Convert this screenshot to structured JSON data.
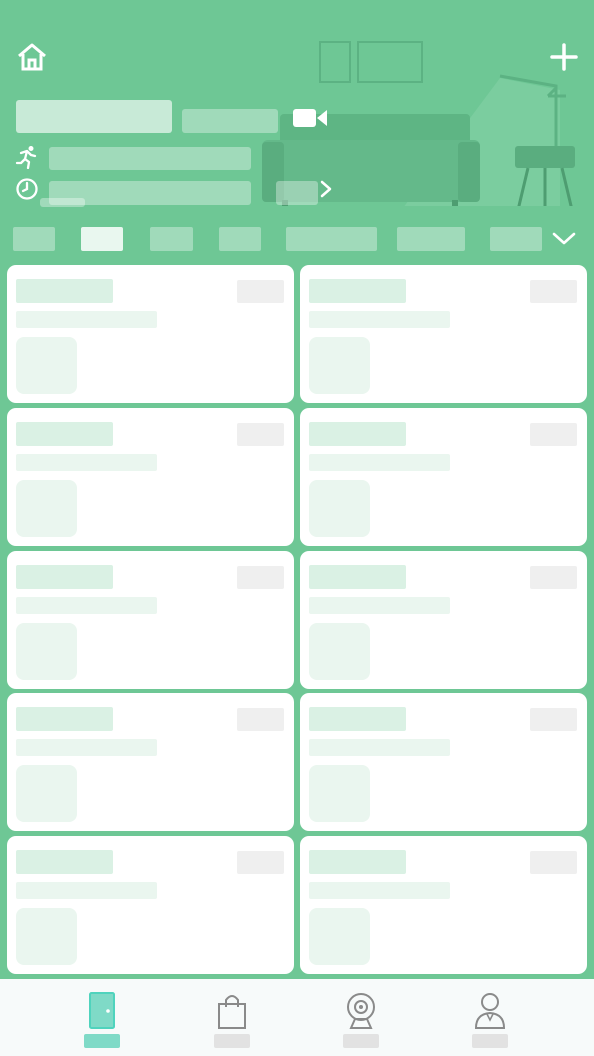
{
  "header": {
    "home_icon": "home-icon",
    "add_icon": "plus-icon",
    "camera_icon": "video-camera-icon",
    "activity_icon": "running-person-icon",
    "schedule_icon": "clock-icon",
    "more_icon": "chevron-right-icon"
  },
  "tabs": {
    "count": 7,
    "active_index": 1,
    "expand_icon": "chevron-down-icon"
  },
  "device_cards": {
    "count": 10,
    "columns": 2
  },
  "bottom_nav": {
    "items": [
      {
        "icon": "door-icon",
        "active": true
      },
      {
        "icon": "shopping-bag-icon",
        "active": false
      },
      {
        "icon": "webcam-icon",
        "active": false
      },
      {
        "icon": "user-profile-icon",
        "active": false
      }
    ]
  },
  "colors": {
    "primary": "#6ec795",
    "card": "#ffffff",
    "card_placeholder": "#daf1e4",
    "nav_active": "#4fd3bd",
    "nav_inactive": "#8a8a8a",
    "nav_background": "#f7fafa"
  }
}
